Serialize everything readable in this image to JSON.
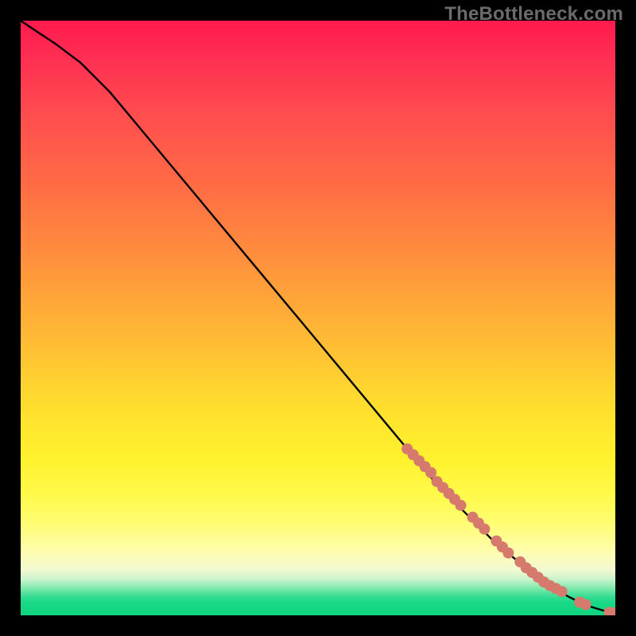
{
  "watermark": "TheBottleneck.com",
  "chart_data": {
    "type": "line",
    "title": "",
    "xlabel": "",
    "ylabel": "",
    "xlim": [
      0,
      100
    ],
    "ylim": [
      0,
      100
    ],
    "series": [
      {
        "name": "curve",
        "x": [
          0,
          3,
          6,
          10,
          15,
          20,
          25,
          30,
          35,
          40,
          45,
          50,
          55,
          60,
          65,
          70,
          75,
          80,
          85,
          88,
          90,
          92,
          94,
          96,
          98,
          100
        ],
        "y": [
          100,
          98,
          96,
          93,
          88,
          82,
          76,
          70,
          64,
          58,
          52,
          46,
          40,
          34,
          28,
          22,
          17,
          12,
          8,
          6,
          4.5,
          3.2,
          2.2,
          1.4,
          0.8,
          0.4
        ]
      }
    ],
    "markers": {
      "name": "highlight-points",
      "color": "#d77a6e",
      "x": [
        65,
        66,
        67,
        68,
        69,
        70,
        71,
        72,
        73,
        74,
        76,
        77,
        78,
        80,
        81,
        82,
        84,
        85,
        86,
        87,
        88,
        89,
        90,
        91,
        94,
        95,
        99,
        100
      ],
      "y": [
        28,
        27,
        26,
        25,
        24,
        22.5,
        21.5,
        20.5,
        19.5,
        18.5,
        16.5,
        15.5,
        14.5,
        12.5,
        11.5,
        10.5,
        9,
        8,
        7.2,
        6.4,
        5.6,
        5,
        4.5,
        4,
        2.2,
        1.8,
        0.5,
        0.4
      ]
    },
    "background_gradient": {
      "top": "#ff1a4d",
      "mid": "#ffe42d",
      "bottom": "#0fd480"
    }
  }
}
